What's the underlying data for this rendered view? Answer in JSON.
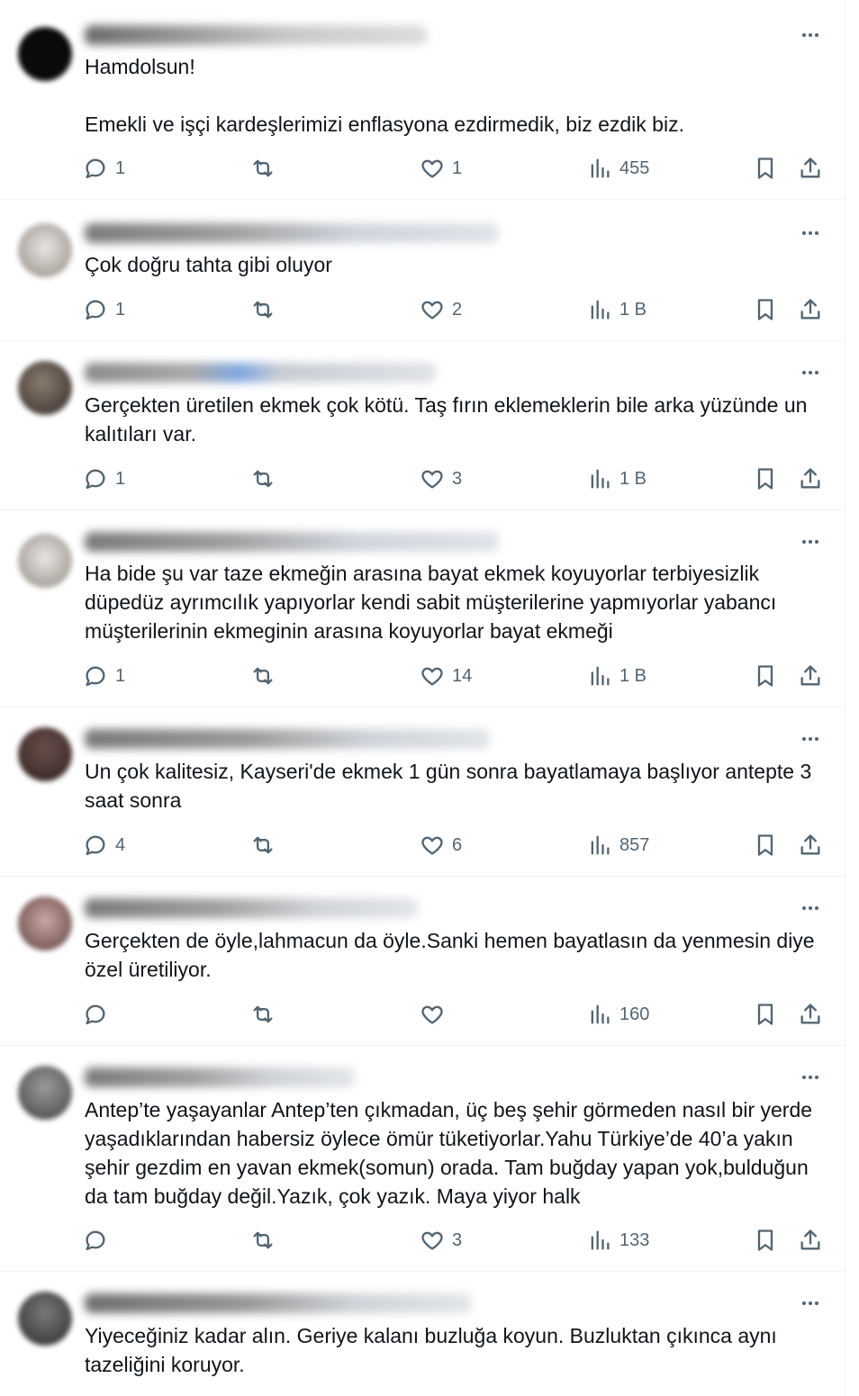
{
  "replies": [
    {
      "text": "Hamdolsun!\n\nEmekli ve işçi kardeşlerimizi enflasyona ezdirmedik, biz ezdik biz.",
      "counts": {
        "reply": "1",
        "repost": "",
        "like": "1",
        "views": "455"
      }
    },
    {
      "text": "Çok doğru tahta gibi oluyor",
      "counts": {
        "reply": "1",
        "repost": "",
        "like": "2",
        "views": "1 B"
      }
    },
    {
      "text": "Gerçekten üretilen ekmek çok kötü. Taş fırın eklemeklerin bile arka yüzünde un kalıtıları var.",
      "counts": {
        "reply": "1",
        "repost": "",
        "like": "3",
        "views": "1 B"
      }
    },
    {
      "text": "Ha bide şu var taze ekmeğin arasına bayat ekmek koyuyorlar terbiyesizlik düpedüz ayrımcılık yapıyorlar kendi sabit müşterilerine yapmıyorlar yabancı müşterilerinin ekmeginin arasına koyuyorlar bayat ekmeği",
      "counts": {
        "reply": "1",
        "repost": "",
        "like": "14",
        "views": "1 B"
      }
    },
    {
      "text": "Un çok kalitesiz, Kayseri'de ekmek 1 gün sonra bayatlamaya başlıyor antepte 3 saat sonra",
      "counts": {
        "reply": "4",
        "repost": "",
        "like": "6",
        "views": "857"
      }
    },
    {
      "text": "Gerçekten de öyle,lahmacun da öyle.Sanki hemen bayatlasın da yenmesin diye özel üretiliyor.",
      "counts": {
        "reply": "",
        "repost": "",
        "like": "",
        "views": "160"
      }
    },
    {
      "text": "Antep’te yaşayanlar Antep’ten çıkmadan, üç beş şehir görmeden nasıl bir yerde yaşadıklarından habersiz öylece ömür tüketiyorlar.Yahu Türkiye’de 40’a yakın şehir gezdim en yavan ekmek(somun) orada. Tam buğday yapan yok,bulduğun da tam buğday değil.Yazık, çok yazık. Maya yiyor halk",
      "counts": {
        "reply": "",
        "repost": "",
        "like": "3",
        "views": "133"
      }
    },
    {
      "text": "Yiyeceğiniz kadar alın. Geriye kalanı buzluğa koyun. Buzluktan çıkınca aynı tazeliğini koruyor.",
      "counts": null
    }
  ],
  "icons": {
    "reply": "speech-bubble-icon",
    "repost": "repost-arrows-icon",
    "like": "heart-icon",
    "views": "bar-chart-icon",
    "bookmark": "bookmark-icon",
    "share": "share-upload-icon",
    "more": "more-dots-icon"
  },
  "colors": {
    "text": "#0f1419",
    "secondary": "#536471",
    "divider": "#eff3f4"
  }
}
